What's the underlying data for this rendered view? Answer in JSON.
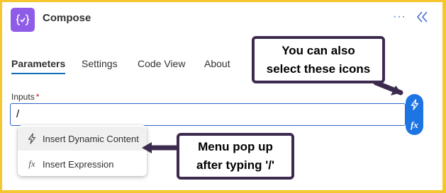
{
  "header": {
    "title": "Compose",
    "app_icon_glyph": "{✓}",
    "more_label": "···"
  },
  "tabs": [
    {
      "label": "Parameters",
      "active": true
    },
    {
      "label": "Settings",
      "active": false
    },
    {
      "label": "Code View",
      "active": false
    },
    {
      "label": "About",
      "active": false
    }
  ],
  "inputs": {
    "label": "Inputs",
    "required_mark": "*",
    "value": "/"
  },
  "menu": {
    "items": [
      {
        "label": "Insert Dynamic Content",
        "icon": "lightning-icon"
      },
      {
        "label": "Insert Expression",
        "icon": "fx-icon"
      }
    ]
  },
  "callouts": {
    "icons": [
      "You can also",
      "select these icons"
    ],
    "menu": [
      "Menu pop up",
      "after typing '/'"
    ]
  },
  "colors": {
    "accent": "#0f6cbd",
    "app_icon": "#8f5ce8",
    "frame": "#f6c62e",
    "callout_border": "#3d2a4f"
  }
}
